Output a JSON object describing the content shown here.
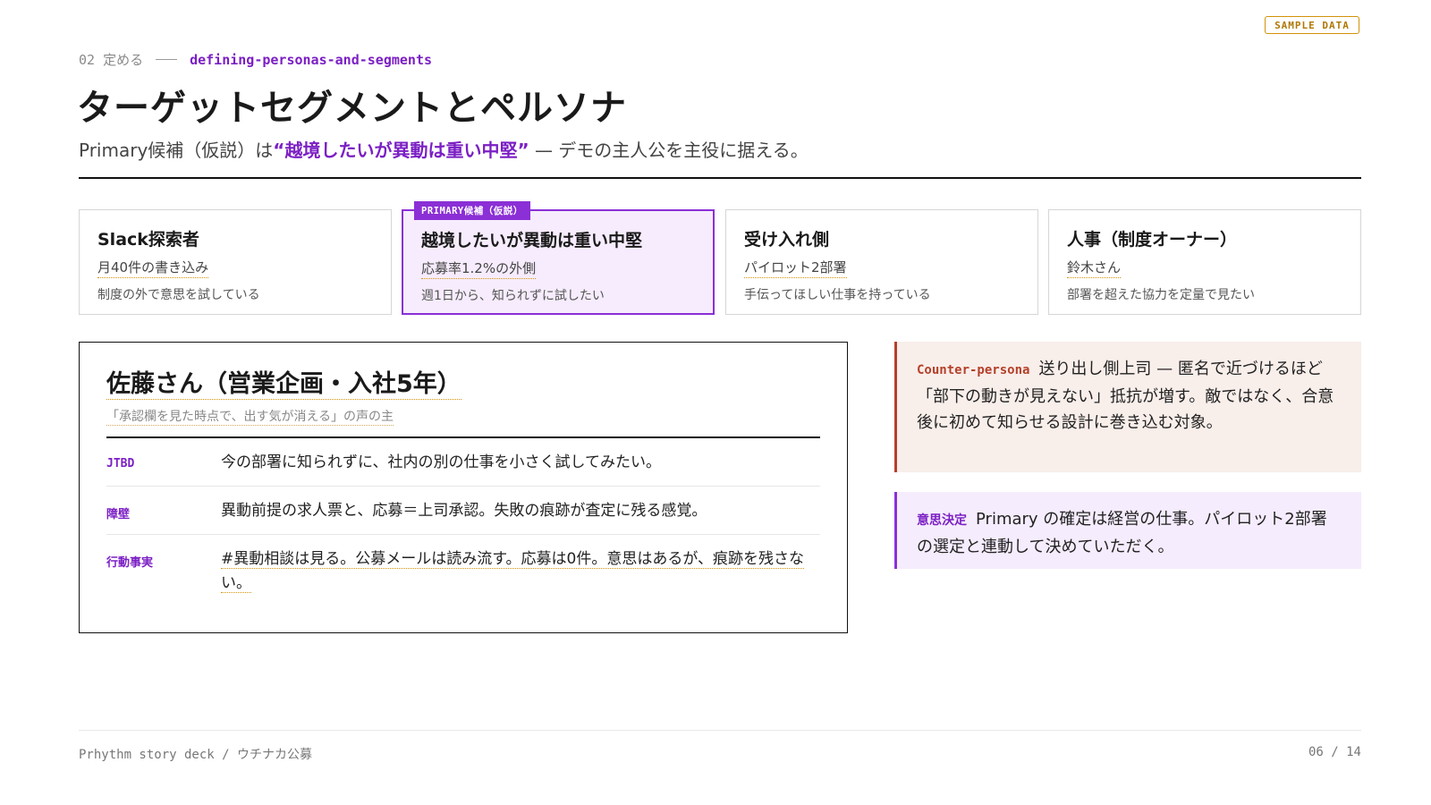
{
  "badge": "SAMPLE DATA",
  "eyebrow": {
    "number": "02 定める",
    "slug": "defining-personas-and-segments"
  },
  "title": "ターゲットセグメントとペルソナ",
  "subtitle": {
    "prefix": "Primary候補（仮説）は",
    "highlight": "“越境したいが異動は重い中堅”",
    "suffix": " — デモの主人公を主役に据える。"
  },
  "segments": [
    {
      "name": "Slack探索者",
      "stat": "月40件の書き込み",
      "desc": "制度の外で意思を試している"
    },
    {
      "tag": "PRIMARY候補（仮説）",
      "name": "越境したいが異動は重い中堅",
      "stat": "応募率1.2%の外側",
      "desc": "週1日から、知られずに試したい"
    },
    {
      "name": "受け入れ側",
      "stat": "パイロット2部署",
      "desc": "手伝ってほしい仕事を持っている"
    },
    {
      "name": "人事（制度オーナー）",
      "stat": "鈴木さん",
      "desc": "部署を超えた協力を定量で見たい"
    }
  ],
  "persona": {
    "name": "佐藤さん（営業企画・入社5年）",
    "quote": "「承認欄を見た時点で、出す気が消える」の声の主",
    "rows": [
      {
        "key": "JTBD",
        "value": "今の部署に知られずに、社内の別の仕事を小さく試してみたい。"
      },
      {
        "key": "障壁",
        "value": "異動前提の求人票と、応募＝上司承認。失敗の痕跡が査定に残る感覚。"
      },
      {
        "key": "行動事実",
        "value": "#異動相談は見る。公募メールは読み流す。応募は0件。意思はあるが、痕跡を残さない。"
      }
    ]
  },
  "counter": {
    "label": "Counter-persona",
    "text": "送り出し側上司 — 匿名で近づけるほど「部下の動きが見えない」抵抗が増す。敵ではなく、合意後に初めて知らせる設計に巻き込む対象。"
  },
  "decision": {
    "label": "意思決定",
    "text": "Primary の確定は経営の仕事。パイロット2部署の選定と連動して決めていただく。"
  },
  "footer": {
    "left": "Prhythm story deck / ウチナカ公募",
    "page": "06 / 14"
  },
  "colors": {
    "accent": "#8b2fd6",
    "counter": "#b5402a",
    "highlight_underline": "#d4920a"
  }
}
